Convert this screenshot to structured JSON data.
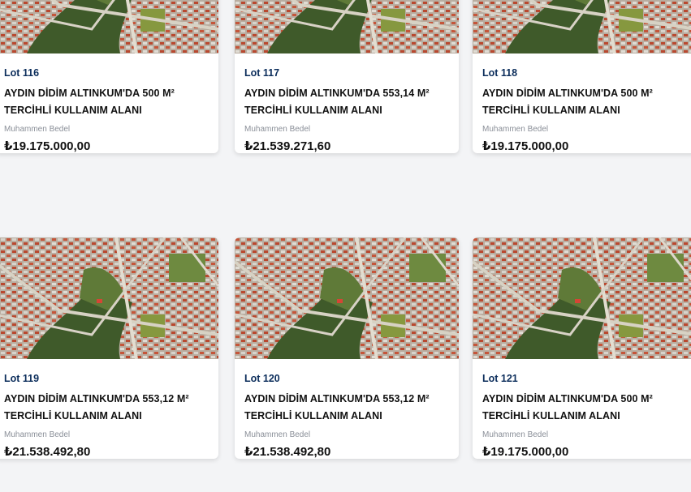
{
  "listings": [
    {
      "lot": "Lot 116",
      "title_line1": "AYDIN DİDİM ALTINKUM'DA 500 M²",
      "title_line2": "TERCİHLİ KULLANIM ALANI",
      "price_label": "Muhammen Bedel",
      "price": "₺19.175.000,00",
      "image": "aerial-map-thumbnail"
    },
    {
      "lot": "Lot 117",
      "title_line1": "AYDIN DİDİM ALTINKUM'DA 553,14 M²",
      "title_line2": "TERCİHLİ KULLANIM ALANI",
      "price_label": "Muhammen Bedel",
      "price": "₺21.539.271,60",
      "image": "aerial-map-thumbnail"
    },
    {
      "lot": "Lot 118",
      "title_line1": "AYDIN DİDİM ALTINKUM'DA 500 M²",
      "title_line2": "TERCİHLİ KULLANIM ALANI",
      "price_label": "Muhammen Bedel",
      "price": "₺19.175.000,00",
      "image": "aerial-map-thumbnail"
    },
    {
      "lot": "Lot 119",
      "title_line1": "AYDIN DİDİM ALTINKUM'DA 553,12 M²",
      "title_line2": "TERCİHLİ KULLANIM ALANI",
      "price_label": "Muhammen Bedel",
      "price": "₺21.538.492,80",
      "image": "aerial-map-thumbnail"
    },
    {
      "lot": "Lot 120",
      "title_line1": "AYDIN DİDİM ALTINKUM'DA 553,12 M²",
      "title_line2": "TERCİHLİ KULLANIM ALANI",
      "price_label": "Muhammen Bedel",
      "price": "₺21.538.492,80",
      "image": "aerial-map-thumbnail"
    },
    {
      "lot": "Lot 121",
      "title_line1": "AYDIN DİDİM ALTINKUM'DA 500 M²",
      "title_line2": "TERCİHLİ KULLANIM ALANI",
      "price_label": "Muhammen Bedel",
      "price": "₺19.175.000,00",
      "image": "aerial-map-thumbnail"
    }
  ]
}
